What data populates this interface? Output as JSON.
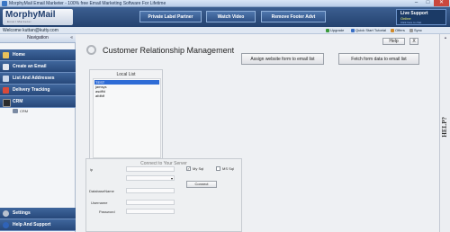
{
  "window": {
    "title": "MorphyMail Email Marketer - 100% free Email Marketing Software For Lifetime"
  },
  "header": {
    "logo": "MorphyMail",
    "logo_sub": "Email Marketer",
    "buttons": [
      "Private Label Partner",
      "Watch Video",
      "Remove Footer Advt"
    ],
    "live_support": {
      "title": "Live Support",
      "status": "Online",
      "link": "Click here to chat"
    }
  },
  "welcome_bar": {
    "text": "Welcome  kuttan@kutty.com",
    "links": [
      "Upgrade",
      "Quick Start Tutorial",
      "Offers",
      "Sync"
    ]
  },
  "sidebar": {
    "header": "Navigation",
    "items": [
      {
        "label": "Home",
        "icon": "home-icon"
      },
      {
        "label": "Create an Email",
        "icon": "email-icon"
      },
      {
        "label": "List And Addresses",
        "icon": "list-icon"
      },
      {
        "label": "Delivery Tracking",
        "icon": "tracking-icon"
      },
      {
        "label": "CRM",
        "icon": "crm-icon"
      }
    ],
    "crm_sub": "CRM",
    "bottom_items": [
      {
        "label": "Settings",
        "icon": "settings-icon"
      },
      {
        "label": "Help And Support",
        "icon": "help-icon"
      }
    ]
  },
  "main": {
    "title": "Customer Relationship Management",
    "help_button": "Help",
    "close_button": "X",
    "assign_button": "Assign website form to email list",
    "fetch_button": "Fetch form data to email list",
    "local_list": {
      "caption": "Local List",
      "items": [
        "TEST",
        "jamsys",
        "asdffd",
        "afdfdf"
      ]
    },
    "server": {
      "caption": "Connect to Your Server",
      "ip_label": "ip",
      "mysql_label": "My Sql",
      "mssql_label": "MS Sql",
      "mysql_checked": true,
      "db_label": "DatabaseName",
      "user_label": "Username",
      "pass_label": "Password",
      "connect_button": "Connect"
    }
  },
  "help_strip": {
    "label": "HELP?"
  }
}
